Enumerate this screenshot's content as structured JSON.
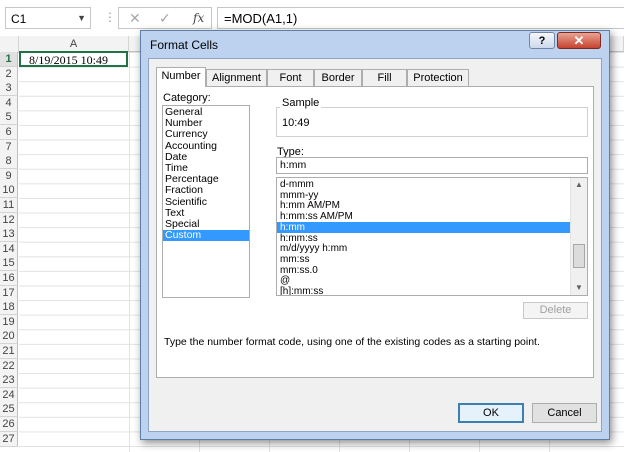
{
  "formula_bar": {
    "name_box": "C1",
    "cancel_icon": "✕",
    "enter_icon": "✓",
    "fx_label": "fx",
    "formula": "=MOD(A1,1)"
  },
  "grid": {
    "column_headers": [
      "A"
    ],
    "row_headers": [
      "1",
      "2",
      "3",
      "4",
      "5",
      "6",
      "7",
      "8",
      "9",
      "10",
      "11",
      "12",
      "13",
      "14",
      "15",
      "16",
      "17",
      "18",
      "19",
      "20",
      "21",
      "22",
      "23",
      "24",
      "25",
      "26",
      "27"
    ],
    "cell_a1": "8/19/2015 10:49"
  },
  "dialog": {
    "title": "Format Cells",
    "help_label": "?",
    "close_label": "✕",
    "tabs": [
      "Number",
      "Alignment",
      "Font",
      "Border",
      "Fill",
      "Protection"
    ],
    "category_label": "Category:",
    "categories": [
      "General",
      "Number",
      "Currency",
      "Accounting",
      "Date",
      "Time",
      "Percentage",
      "Fraction",
      "Scientific",
      "Text",
      "Special",
      "Custom"
    ],
    "selected_category": "Custom",
    "sample_label": "Sample",
    "sample_value": "10:49",
    "type_label": "Type:",
    "type_value": "h:mm",
    "type_list": [
      "d-mmm",
      "mmm-yy",
      "h:mm AM/PM",
      "h:mm:ss AM/PM",
      "h:mm",
      "h:mm:ss",
      "m/d/yyyy h:mm",
      "mm:ss",
      "mm:ss.0",
      "@",
      "[h]:mm:ss"
    ],
    "selected_type": "h:mm",
    "delete_label": "Delete",
    "description": "Type the number format code, using one of the existing codes as a starting point.",
    "ok_label": "OK",
    "cancel_label": "Cancel"
  }
}
